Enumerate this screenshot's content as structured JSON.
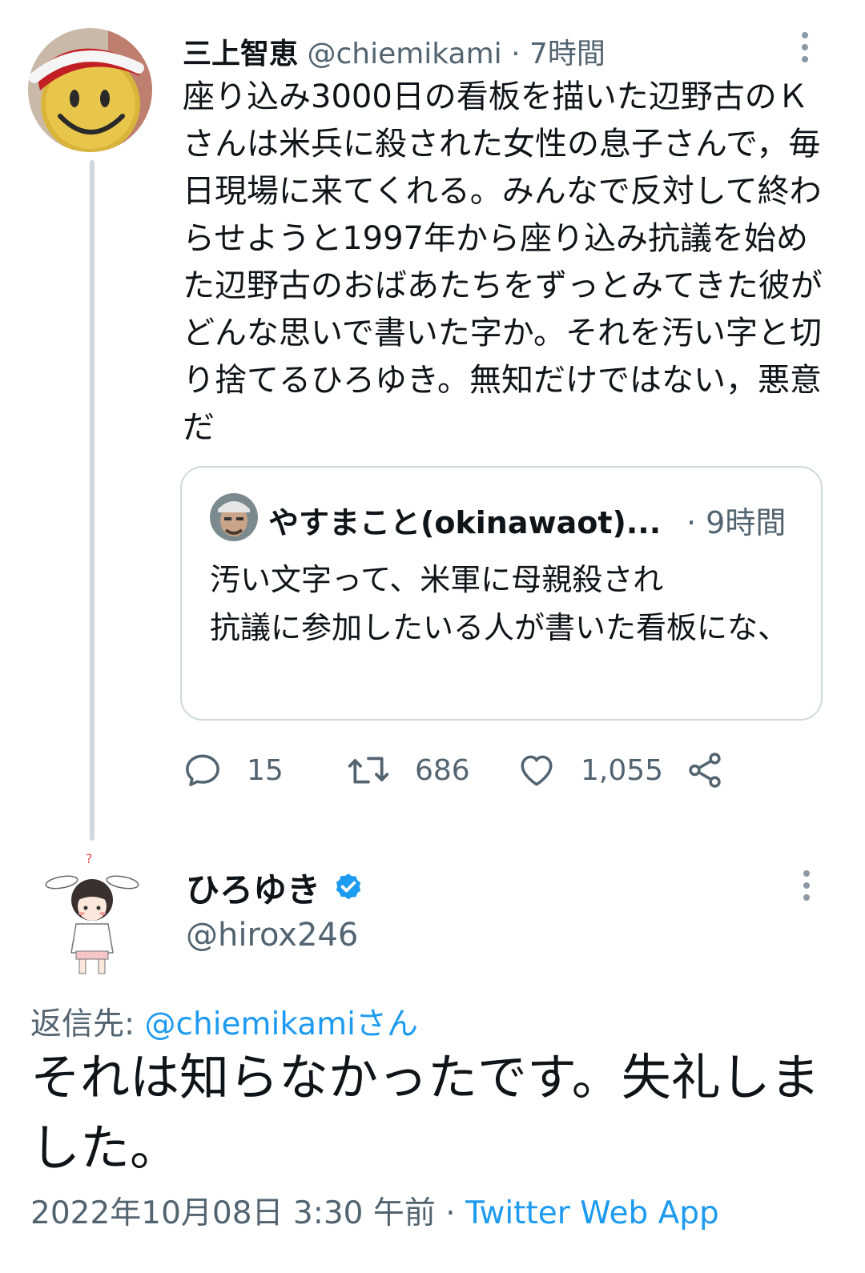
{
  "tweet1": {
    "name": "三上智恵",
    "handle": "@chiemikami",
    "time": "· 7時間",
    "text": "座り込み3000日の看板を描いた辺野古のＫさんは米兵に殺された女性の息子さんで，毎日現場に来てくれる。みんなで反対して終わらせようと1997年から座り込み抗議を始めた辺野古のおばあたちをずっとみてきた彼がどんな思いで書いた字か。それを汚い字と切り捨てるひろゆき。無知だけではない，悪意だ",
    "quote": {
      "name": "やすまこと(okinawaot)...",
      "time": "· 9時間",
      "text": "汚い文字って、米軍に母親殺され\n抗議に参加したいる人が書いた看板にな、"
    },
    "replies": "15",
    "retweets": "686",
    "likes": "1,055"
  },
  "tweet2": {
    "name": "ひろゆき",
    "handle": "@hirox246",
    "reply_to_label": "返信先: ",
    "reply_to_handle": "@chiemikamiさん",
    "text": "それは知らなかったです。失礼しました。",
    "timestamp": "2022年10月08日 3:30 午前 · ",
    "source": "Twitter Web App"
  },
  "colors": {
    "accent": "#1d9bf0",
    "secondary_text": "#536471",
    "border": "#cfd9de"
  },
  "icons": [
    "more-vertical-icon",
    "reply-icon",
    "retweet-icon",
    "like-icon",
    "share-icon",
    "verified-badge-icon"
  ]
}
